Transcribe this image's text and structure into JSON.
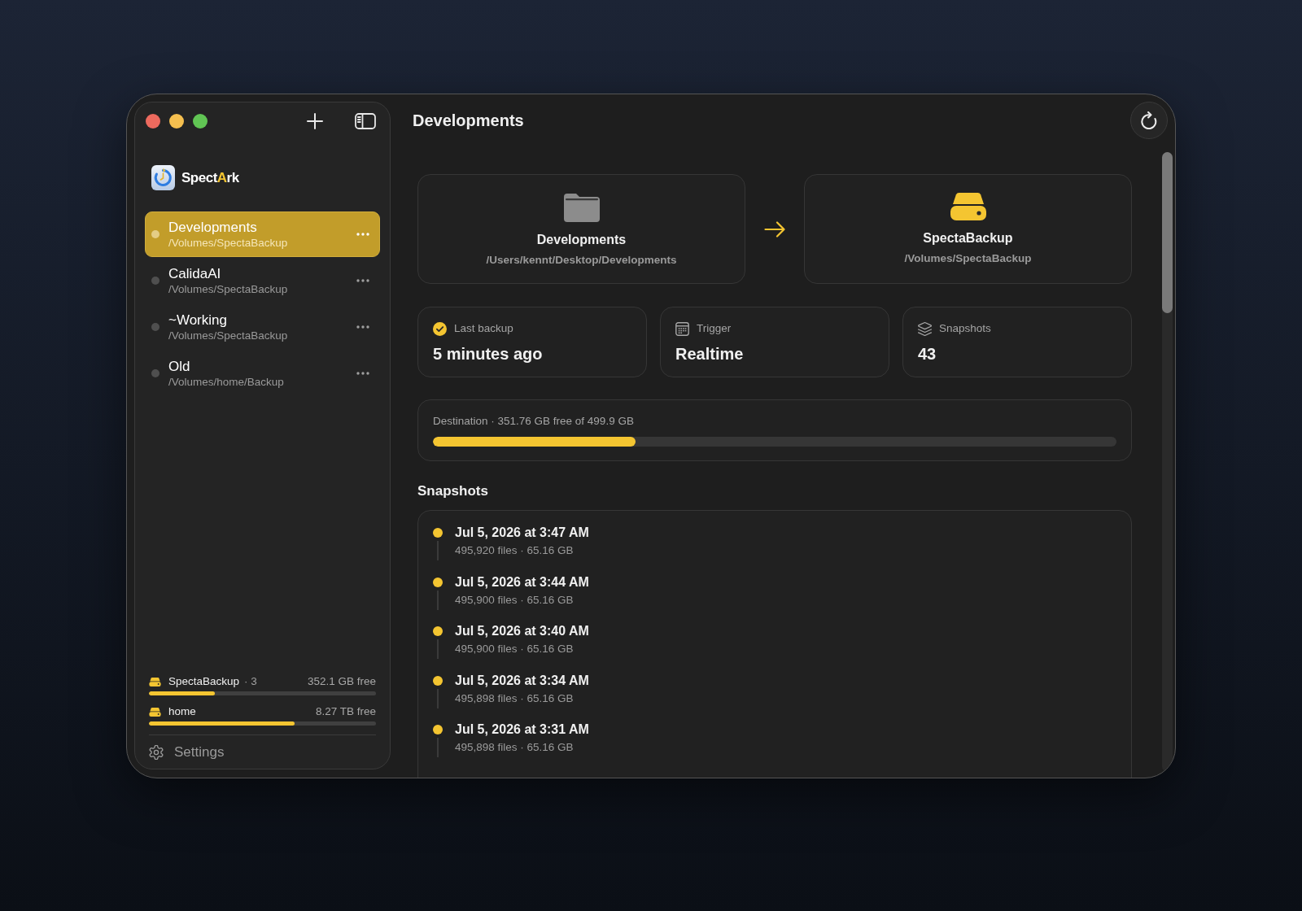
{
  "sidebar": {
    "app_name": [
      {
        "text": "Spect",
        "accent": false
      },
      {
        "text": "A",
        "accent": true
      },
      {
        "text": "rk",
        "accent": false
      }
    ],
    "items": [
      {
        "name": "Developments",
        "path": "/Volumes/SpectaBackup",
        "selected": true
      },
      {
        "name": "CalidaAI",
        "path": "/Volumes/SpectaBackup",
        "selected": false
      },
      {
        "name": "~Working",
        "path": "/Volumes/SpectaBackup",
        "selected": false
      },
      {
        "name": "Old",
        "path": "/Volumes/home/Backup",
        "selected": false
      }
    ],
    "volumes": [
      {
        "name": "SpectaBackup",
        "count": "· 3",
        "free": "352.1 GB free",
        "level": 0.29
      },
      {
        "name": "home",
        "free": "8.27 TB free",
        "level": 0.64
      }
    ],
    "settings": "Settings"
  },
  "main": {
    "title": "Developments",
    "source": {
      "name": "Developments",
      "path": "/Users/kennt/Desktop/Developments"
    },
    "destination": {
      "name": "SpectaBackup",
      "path": "/Volumes/SpectaBackup"
    },
    "stats": [
      {
        "kind": "status",
        "label": "Last backup",
        "value": "5 minutes ago"
      },
      {
        "kind": "trigger",
        "label": "Trigger",
        "value": "Realtime"
      },
      {
        "kind": "count",
        "label": "Snapshots",
        "value": "43"
      }
    ],
    "capacity": {
      "label": "Destination · 351.76 GB free of 499.9 GB",
      "level": 0.296
    },
    "snapshots": {
      "heading": "Snapshots",
      "items": [
        {
          "date": "Jul 5, 2026 at 3:47 AM",
          "details": "495,920 files · 65.16 GB"
        },
        {
          "date": "Jul 5, 2026 at 3:44 AM",
          "details": "495,900 files · 65.16 GB"
        },
        {
          "date": "Jul 5, 2026 at 3:40 AM",
          "details": "495,900 files · 65.16 GB"
        },
        {
          "date": "Jul 5, 2026 at 3:34 AM",
          "details": "495,898 files · 65.16 GB"
        },
        {
          "date": "Jul 5, 2026 at 3:31 AM",
          "details": "495,898 files · 65.16 GB"
        }
      ]
    }
  }
}
